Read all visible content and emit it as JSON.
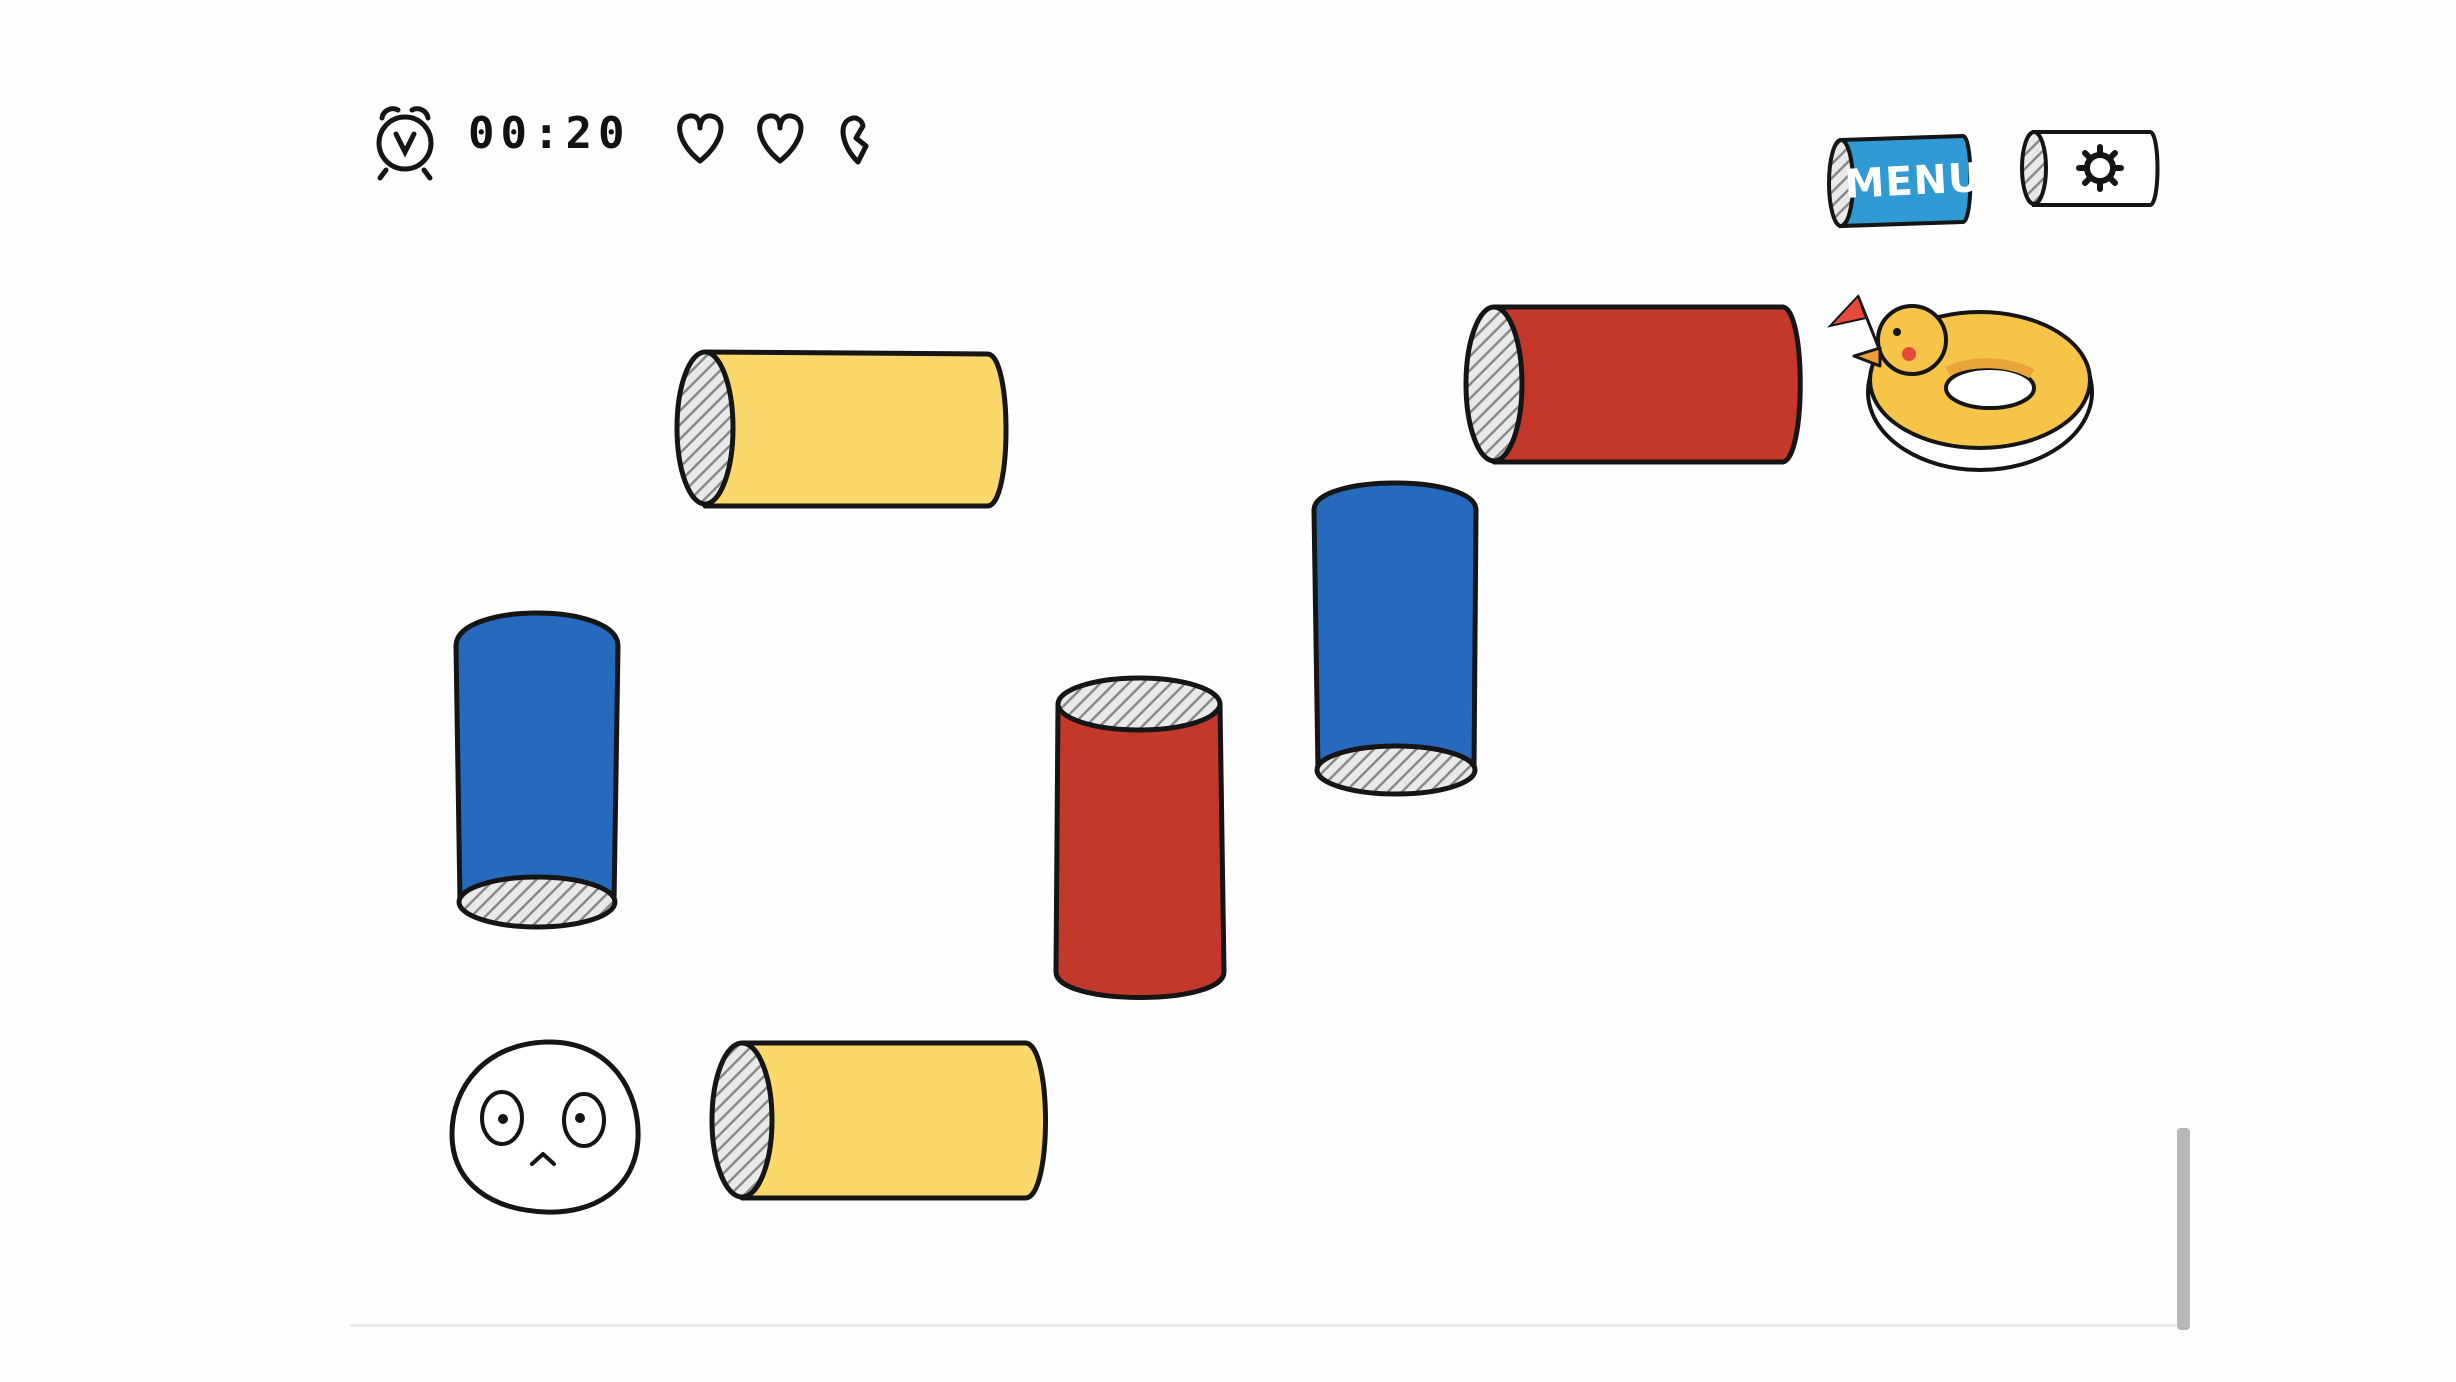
{
  "hud": {
    "timer": "00:20",
    "timer_icon": "alarm-clock-icon",
    "lives_total": 3,
    "lives_full": 2,
    "lives_broken": 1,
    "heart_icon": "heart-outline-icon",
    "broken_heart_icon": "broken-heart-icon"
  },
  "buttons": {
    "menu_label": "MENU",
    "menu_color": "#2f9ad4",
    "settings_icon": "gear-icon"
  },
  "colors": {
    "red": "#c2392b",
    "blue": "#2769bd",
    "yellow": "#fbd86a",
    "duck_yellow": "#f7c44a",
    "ink": "#151515"
  },
  "board": {
    "pipes": [
      {
        "name": "pipe-yellow-top",
        "color": "yellow",
        "orientation": "horizontal"
      },
      {
        "name": "pipe-red-top-right",
        "color": "red",
        "orientation": "horizontal"
      },
      {
        "name": "pipe-blue-left",
        "color": "blue",
        "orientation": "vertical"
      },
      {
        "name": "pipe-red-center",
        "color": "red",
        "orientation": "vertical"
      },
      {
        "name": "pipe-blue-center",
        "color": "blue",
        "orientation": "vertical"
      },
      {
        "name": "pipe-yellow-bottom",
        "color": "yellow",
        "orientation": "horizontal"
      }
    ],
    "character": "worried-blob-character",
    "goal": "duck-float-ring"
  }
}
